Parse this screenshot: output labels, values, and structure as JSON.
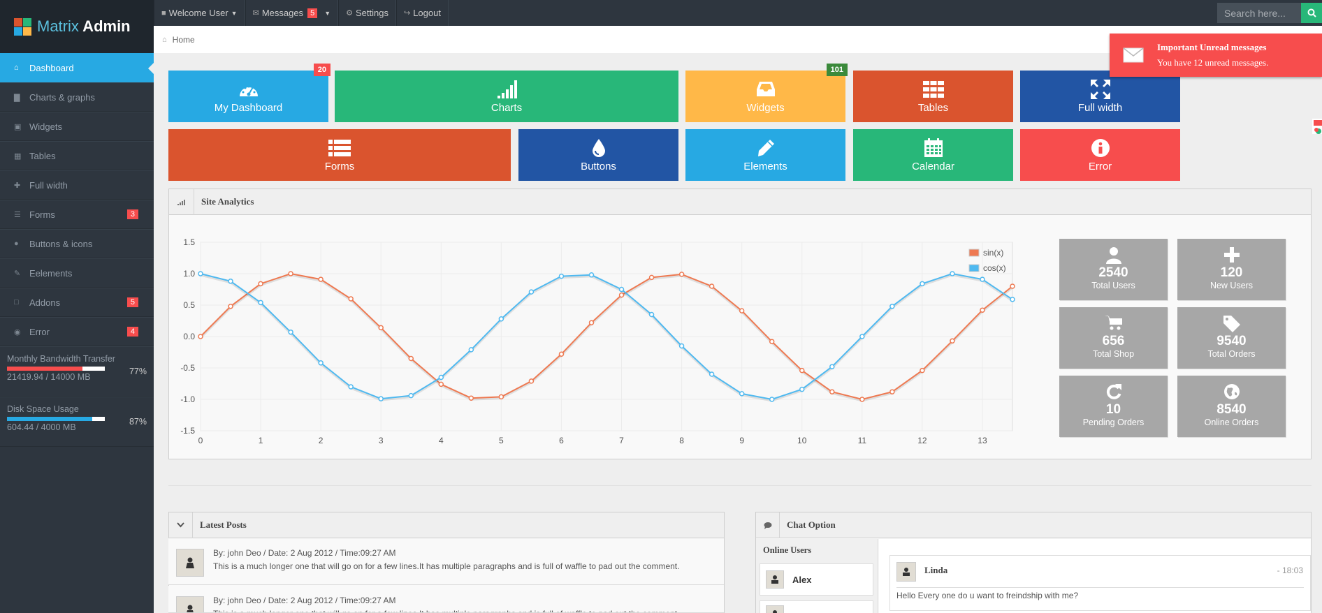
{
  "brand": {
    "part1": "Matrix",
    "part2": " Admin"
  },
  "topnav": {
    "welcome": "Welcome User",
    "messages": "Messages",
    "messages_count": "5",
    "settings": "Settings",
    "logout": "Logout"
  },
  "search": {
    "placeholder": "Search here..."
  },
  "breadcrumb": {
    "home": "Home"
  },
  "notification": {
    "title": "Important Unread messages",
    "body": "You have 12 unread messages."
  },
  "sidebar": {
    "items": [
      {
        "label": "Dashboard",
        "icon": "home-icon",
        "badge": ""
      },
      {
        "label": "Charts & graphs",
        "icon": "signal-icon",
        "badge": ""
      },
      {
        "label": "Widgets",
        "icon": "inbox-icon",
        "badge": ""
      },
      {
        "label": "Tables",
        "icon": "table-icon",
        "badge": ""
      },
      {
        "label": "Full width",
        "icon": "fullscreen-icon",
        "badge": ""
      },
      {
        "label": "Forms",
        "icon": "list-icon",
        "badge": "3"
      },
      {
        "label": "Buttons & icons",
        "icon": "tint-icon",
        "badge": ""
      },
      {
        "label": "Eelements",
        "icon": "pencil-icon",
        "badge": ""
      },
      {
        "label": "Addons",
        "icon": "file-icon",
        "badge": "5"
      },
      {
        "label": "Error",
        "icon": "info-icon",
        "badge": "4"
      }
    ],
    "bandwidth": {
      "label": "Monthly Bandwidth Transfer",
      "percent": "77%",
      "value": "21419.94 / 14000 MB",
      "fraction": 0.77
    },
    "disk": {
      "label": "Disk Space Usage",
      "percent": "87%",
      "value": "604.44 / 4000 MB",
      "fraction": 0.87
    }
  },
  "tiles": [
    {
      "label": "My Dashboard",
      "icon": "dashboard-icon",
      "color": "#27a9e3",
      "badge": "20",
      "badge_color": "#f74d4d"
    },
    {
      "label": "Charts",
      "icon": "signal-icon",
      "color": "#28b779",
      "badge": ""
    },
    {
      "label": "Widgets",
      "icon": "inbox-icon",
      "color": "#ffb848",
      "badge": "101",
      "badge_color": "#3b8a3b"
    },
    {
      "label": "Tables",
      "icon": "table-icon",
      "color": "#da542e",
      "badge": ""
    },
    {
      "label": "Full width",
      "icon": "fullscreen-icon",
      "color": "#2255a4",
      "badge": ""
    },
    {
      "label": "Forms",
      "icon": "list-icon",
      "color": "#da542e",
      "badge": ""
    },
    {
      "label": "Buttons",
      "icon": "tint-icon",
      "color": "#2255a4",
      "badge": ""
    },
    {
      "label": "Elements",
      "icon": "pencil-icon",
      "color": "#27a9e3",
      "badge": ""
    },
    {
      "label": "Calendar",
      "icon": "calendar-icon",
      "color": "#28b779",
      "badge": ""
    },
    {
      "label": "Error",
      "icon": "info-icon",
      "color": "#f74d4d",
      "badge": ""
    }
  ],
  "analytics": {
    "title": "Site Analytics"
  },
  "chart_data": {
    "type": "line",
    "xlim": [
      0,
      13.5
    ],
    "ylim": [
      -1.5,
      1.5
    ],
    "xticks": [
      "0",
      "1",
      "2",
      "3",
      "4",
      "5",
      "6",
      "7",
      "8",
      "9",
      "10",
      "11",
      "12",
      "13"
    ],
    "yticks": [
      "1.5",
      "1.0",
      "0.5",
      "0.0",
      "-0.5",
      "-1.0",
      "-1.5"
    ],
    "legend_position": "top-right",
    "grid": true,
    "x": [
      0,
      0.5,
      1,
      1.5,
      2,
      2.5,
      3,
      3.5,
      4,
      4.5,
      5,
      5.5,
      6,
      6.5,
      7,
      7.5,
      8,
      8.5,
      9,
      9.5,
      10,
      10.5,
      11,
      11.5,
      12,
      12.5,
      13,
      13.5
    ],
    "series": [
      {
        "name": "sin(x)",
        "color": "#ee7951",
        "values": [
          0.0,
          0.48,
          0.84,
          1.0,
          0.91,
          0.6,
          0.14,
          -0.35,
          -0.76,
          -0.98,
          -0.96,
          -0.71,
          -0.28,
          0.22,
          0.66,
          0.94,
          0.99,
          0.8,
          0.41,
          -0.08,
          -0.54,
          -0.88,
          -1.0,
          -0.88,
          -0.54,
          -0.07,
          0.42,
          0.8
        ]
      },
      {
        "name": "cos(x)",
        "color": "#4fb9f0",
        "values": [
          1.0,
          0.88,
          0.54,
          0.07,
          -0.42,
          -0.8,
          -0.99,
          -0.94,
          -0.65,
          -0.21,
          0.28,
          0.71,
          0.96,
          0.98,
          0.75,
          0.35,
          -0.15,
          -0.6,
          -0.91,
          -1.0,
          -0.84,
          -0.48,
          0.0,
          0.48,
          0.84,
          1.0,
          0.91,
          0.59
        ]
      }
    ]
  },
  "stats": [
    {
      "value": "2540",
      "label": "Total Users",
      "icon": "user-icon"
    },
    {
      "value": "120",
      "label": "New Users",
      "icon": "plus-icon"
    },
    {
      "value": "656",
      "label": "Total Shop",
      "icon": "shopping-cart-icon"
    },
    {
      "value": "9540",
      "label": "Total Orders",
      "icon": "tag-icon"
    },
    {
      "value": "10",
      "label": "Pending Orders",
      "icon": "refresh-icon"
    },
    {
      "value": "8540",
      "label": "Online Orders",
      "icon": "globe-icon"
    }
  ],
  "posts": {
    "title": "Latest Posts",
    "items": [
      {
        "meta": "By: john Deo / Date: 2 Aug 2012 / Time:09:27 AM",
        "text": "This is a much longer one that will go on for a few lines.It has multiple paragraphs and is full of waffle to pad out the comment."
      },
      {
        "meta": "By: john Deo / Date: 2 Aug 2012 / Time:09:27 AM",
        "text": "This is a much longer one that will go on for a few lines.It has multiple paragraphs and is full of waffle to pad out the comment."
      }
    ]
  },
  "chat": {
    "title": "Chat Option",
    "online_label": "Online Users",
    "users": [
      "Alex",
      ""
    ],
    "message": {
      "name": "Linda",
      "time": "- 18:03",
      "text": "Hello Every one do u want to freindship with me?"
    }
  }
}
